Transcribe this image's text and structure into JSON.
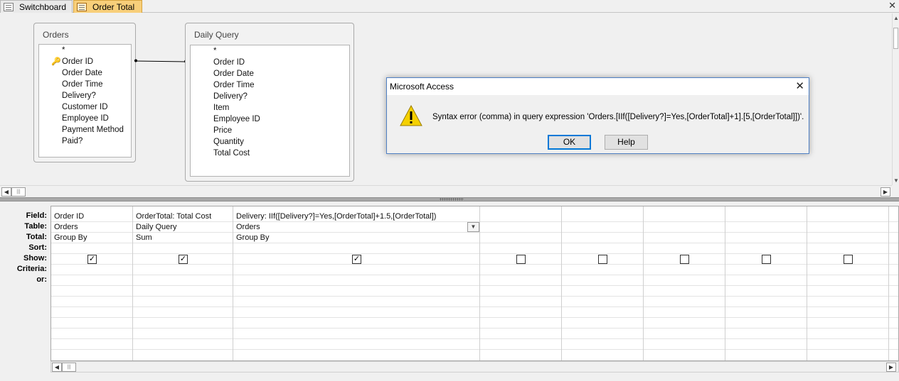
{
  "tabs": [
    {
      "label": "Switchboard",
      "active": false
    },
    {
      "label": "Order Total",
      "active": true
    }
  ],
  "window": {
    "close_glyph": "✕"
  },
  "tables": {
    "orders": {
      "title": "Orders",
      "fields": [
        "*",
        "Order ID",
        "Order Date",
        "Order Time",
        "Delivery?",
        "Customer ID",
        "Employee ID",
        "Payment Method",
        "Paid?"
      ],
      "key_field": "Order ID"
    },
    "daily_query": {
      "title": "Daily Query",
      "fields": [
        "*",
        "Order ID",
        "Order Date",
        "Order Time",
        "Delivery?",
        "Item",
        "Employee ID",
        "Price",
        "Quantity",
        "Total Cost"
      ]
    }
  },
  "grid": {
    "row_labels": [
      "Field:",
      "Table:",
      "Total:",
      "Sort:",
      "Show:",
      "Criteria:",
      "or:"
    ],
    "columns": [
      {
        "field": "Order ID",
        "table": "Orders",
        "total": "Group By",
        "show": true
      },
      {
        "field": "OrderTotal: Total Cost",
        "table": "Daily Query",
        "total": "Sum",
        "show": true
      },
      {
        "field": "Delivery: IIf([Delivery?]=Yes,[OrderTotal]+1.5,[OrderTotal])",
        "table": "Orders",
        "total": "Group By",
        "show": true
      },
      {
        "field": "",
        "table": "",
        "total": "",
        "show": false
      },
      {
        "field": "",
        "table": "",
        "total": "",
        "show": false
      },
      {
        "field": "",
        "table": "",
        "total": "",
        "show": false
      },
      {
        "field": "",
        "table": "",
        "total": "",
        "show": false
      },
      {
        "field": "",
        "table": "",
        "total": "",
        "show": false
      }
    ]
  },
  "dialog": {
    "title": "Microsoft Access",
    "message": "Syntax error (comma) in query expression 'Orders.[IIf([Delivery?]=Yes,[OrderTotal]+1].[5,[OrderTotal]])'.",
    "ok_label": "OK",
    "help_label": "Help",
    "icon": "warning-icon"
  },
  "colors": {
    "active_tab": "#f8cf7a",
    "dialog_border": "#4f80c4",
    "ok_focus": "#0078d7",
    "warning_yellow": "#f5d000"
  }
}
